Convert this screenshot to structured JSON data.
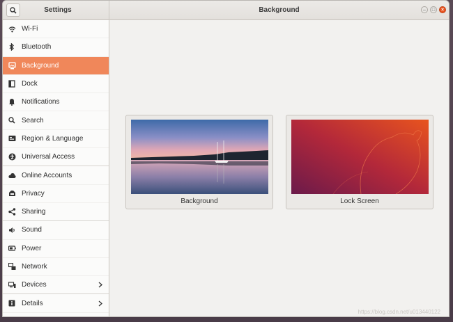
{
  "window": {
    "sidebar_title": "Settings",
    "main_title": "Background"
  },
  "sidebar": {
    "items": [
      {
        "label": "Wi-Fi",
        "icon": "wifi-icon"
      },
      {
        "label": "Bluetooth",
        "icon": "bluetooth-icon"
      },
      {
        "label": "Background",
        "icon": "background-icon",
        "active": true
      },
      {
        "label": "Dock",
        "icon": "dock-icon"
      },
      {
        "label": "Notifications",
        "icon": "bell-icon"
      },
      {
        "label": "Search",
        "icon": "search-icon"
      },
      {
        "label": "Region & Language",
        "icon": "region-icon"
      },
      {
        "label": "Universal Access",
        "icon": "accessibility-icon"
      },
      {
        "label": "Online Accounts",
        "icon": "cloud-icon"
      },
      {
        "label": "Privacy",
        "icon": "privacy-icon"
      },
      {
        "label": "Sharing",
        "icon": "share-icon"
      },
      {
        "label": "Sound",
        "icon": "speaker-icon"
      },
      {
        "label": "Power",
        "icon": "power-icon"
      },
      {
        "label": "Network",
        "icon": "network-icon"
      },
      {
        "label": "Devices",
        "icon": "devices-icon"
      },
      {
        "label": "Details",
        "icon": "info-icon"
      }
    ]
  },
  "main": {
    "cards": [
      {
        "label": "Background"
      },
      {
        "label": "Lock Screen"
      }
    ]
  },
  "colors": {
    "accent": "#f0875a",
    "close": "#e95420"
  },
  "watermark": "https://blog.csdn.net/u013440122"
}
